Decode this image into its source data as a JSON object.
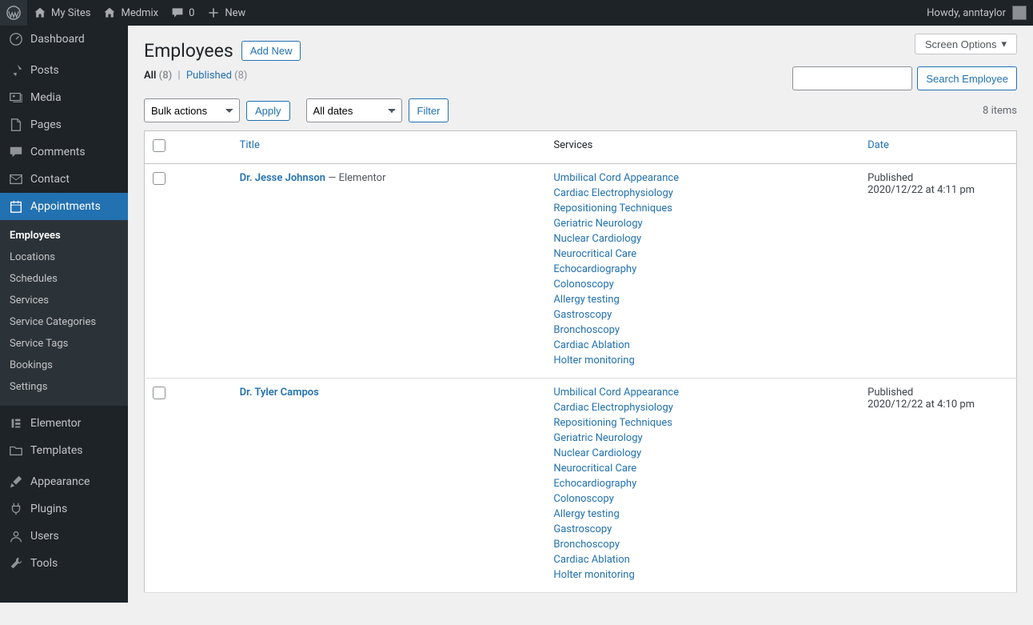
{
  "adminbar": {
    "mysites": "My Sites",
    "sitename": "Medmix",
    "comments": "0",
    "new": "New",
    "howdy": "Howdy, anntaylor"
  },
  "sidebar": {
    "dashboard": "Dashboard",
    "posts": "Posts",
    "media": "Media",
    "pages": "Pages",
    "comments": "Comments",
    "contact": "Contact",
    "appointments": "Appointments",
    "submenu": {
      "employees": "Employees",
      "locations": "Locations",
      "schedules": "Schedules",
      "services": "Services",
      "service_categories": "Service Categories",
      "service_tags": "Service Tags",
      "bookings": "Bookings",
      "settings": "Settings"
    },
    "elementor": "Elementor",
    "templates": "Templates",
    "appearance": "Appearance",
    "plugins": "Plugins",
    "users": "Users",
    "tools": "Tools"
  },
  "header": {
    "screen_options": "Screen Options",
    "title": "Employees",
    "add_new": "Add New"
  },
  "subsubsub": {
    "all": "All",
    "all_count": "(8)",
    "published": "Published",
    "published_count": "(8)"
  },
  "filters": {
    "bulk_actions": "Bulk actions",
    "apply": "Apply",
    "all_dates": "All dates",
    "filter": "Filter",
    "item_count": "8 items"
  },
  "search": {
    "button": "Search Employee"
  },
  "table": {
    "cols": {
      "title": "Title",
      "services": "Services",
      "date": "Date"
    },
    "rows": [
      {
        "title": "Dr. Jesse Johnson",
        "suffix": " — Elementor",
        "services": [
          "Umbilical Cord Appearance",
          "Cardiac Electrophysiology",
          "Repositioning Techniques",
          "Geriatric Neurology",
          "Nuclear Cardiology",
          "Neurocritical Care",
          "Echocardiography",
          "Colonoscopy",
          "Allergy testing",
          "Gastroscopy",
          "Bronchoscopy",
          "Cardiac Ablation",
          "Holter monitoring"
        ],
        "status": "Published",
        "date": "2020/12/22 at 4:11 pm"
      },
      {
        "title": "Dr. Tyler Campos",
        "suffix": "",
        "services": [
          "Umbilical Cord Appearance",
          "Cardiac Electrophysiology",
          "Repositioning Techniques",
          "Geriatric Neurology",
          "Nuclear Cardiology",
          "Neurocritical Care",
          "Echocardiography",
          "Colonoscopy",
          "Allergy testing",
          "Gastroscopy",
          "Bronchoscopy",
          "Cardiac Ablation",
          "Holter monitoring"
        ],
        "status": "Published",
        "date": "2020/12/22 at 4:10 pm"
      }
    ]
  }
}
